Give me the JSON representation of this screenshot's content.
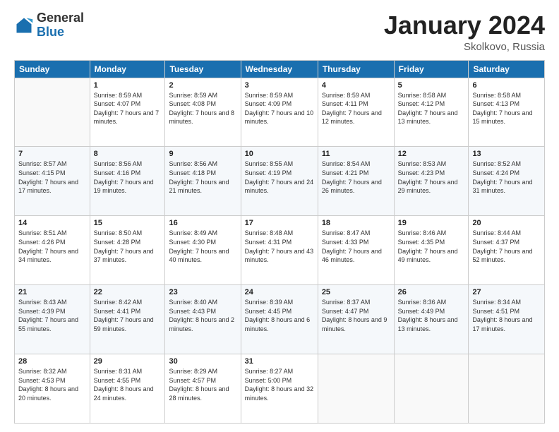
{
  "header": {
    "logo_general": "General",
    "logo_blue": "Blue",
    "month_title": "January 2024",
    "location": "Skolkovo, Russia"
  },
  "weekdays": [
    "Sunday",
    "Monday",
    "Tuesday",
    "Wednesday",
    "Thursday",
    "Friday",
    "Saturday"
  ],
  "weeks": [
    [
      {
        "day": "",
        "sunrise": "",
        "sunset": "",
        "daylight": ""
      },
      {
        "day": "1",
        "sunrise": "Sunrise: 8:59 AM",
        "sunset": "Sunset: 4:07 PM",
        "daylight": "Daylight: 7 hours and 7 minutes."
      },
      {
        "day": "2",
        "sunrise": "Sunrise: 8:59 AM",
        "sunset": "Sunset: 4:08 PM",
        "daylight": "Daylight: 7 hours and 8 minutes."
      },
      {
        "day": "3",
        "sunrise": "Sunrise: 8:59 AM",
        "sunset": "Sunset: 4:09 PM",
        "daylight": "Daylight: 7 hours and 10 minutes."
      },
      {
        "day": "4",
        "sunrise": "Sunrise: 8:59 AM",
        "sunset": "Sunset: 4:11 PM",
        "daylight": "Daylight: 7 hours and 12 minutes."
      },
      {
        "day": "5",
        "sunrise": "Sunrise: 8:58 AM",
        "sunset": "Sunset: 4:12 PM",
        "daylight": "Daylight: 7 hours and 13 minutes."
      },
      {
        "day": "6",
        "sunrise": "Sunrise: 8:58 AM",
        "sunset": "Sunset: 4:13 PM",
        "daylight": "Daylight: 7 hours and 15 minutes."
      }
    ],
    [
      {
        "day": "7",
        "sunrise": "Sunrise: 8:57 AM",
        "sunset": "Sunset: 4:15 PM",
        "daylight": "Daylight: 7 hours and 17 minutes."
      },
      {
        "day": "8",
        "sunrise": "Sunrise: 8:56 AM",
        "sunset": "Sunset: 4:16 PM",
        "daylight": "Daylight: 7 hours and 19 minutes."
      },
      {
        "day": "9",
        "sunrise": "Sunrise: 8:56 AM",
        "sunset": "Sunset: 4:18 PM",
        "daylight": "Daylight: 7 hours and 21 minutes."
      },
      {
        "day": "10",
        "sunrise": "Sunrise: 8:55 AM",
        "sunset": "Sunset: 4:19 PM",
        "daylight": "Daylight: 7 hours and 24 minutes."
      },
      {
        "day": "11",
        "sunrise": "Sunrise: 8:54 AM",
        "sunset": "Sunset: 4:21 PM",
        "daylight": "Daylight: 7 hours and 26 minutes."
      },
      {
        "day": "12",
        "sunrise": "Sunrise: 8:53 AM",
        "sunset": "Sunset: 4:23 PM",
        "daylight": "Daylight: 7 hours and 29 minutes."
      },
      {
        "day": "13",
        "sunrise": "Sunrise: 8:52 AM",
        "sunset": "Sunset: 4:24 PM",
        "daylight": "Daylight: 7 hours and 31 minutes."
      }
    ],
    [
      {
        "day": "14",
        "sunrise": "Sunrise: 8:51 AM",
        "sunset": "Sunset: 4:26 PM",
        "daylight": "Daylight: 7 hours and 34 minutes."
      },
      {
        "day": "15",
        "sunrise": "Sunrise: 8:50 AM",
        "sunset": "Sunset: 4:28 PM",
        "daylight": "Daylight: 7 hours and 37 minutes."
      },
      {
        "day": "16",
        "sunrise": "Sunrise: 8:49 AM",
        "sunset": "Sunset: 4:30 PM",
        "daylight": "Daylight: 7 hours and 40 minutes."
      },
      {
        "day": "17",
        "sunrise": "Sunrise: 8:48 AM",
        "sunset": "Sunset: 4:31 PM",
        "daylight": "Daylight: 7 hours and 43 minutes."
      },
      {
        "day": "18",
        "sunrise": "Sunrise: 8:47 AM",
        "sunset": "Sunset: 4:33 PM",
        "daylight": "Daylight: 7 hours and 46 minutes."
      },
      {
        "day": "19",
        "sunrise": "Sunrise: 8:46 AM",
        "sunset": "Sunset: 4:35 PM",
        "daylight": "Daylight: 7 hours and 49 minutes."
      },
      {
        "day": "20",
        "sunrise": "Sunrise: 8:44 AM",
        "sunset": "Sunset: 4:37 PM",
        "daylight": "Daylight: 7 hours and 52 minutes."
      }
    ],
    [
      {
        "day": "21",
        "sunrise": "Sunrise: 8:43 AM",
        "sunset": "Sunset: 4:39 PM",
        "daylight": "Daylight: 7 hours and 55 minutes."
      },
      {
        "day": "22",
        "sunrise": "Sunrise: 8:42 AM",
        "sunset": "Sunset: 4:41 PM",
        "daylight": "Daylight: 7 hours and 59 minutes."
      },
      {
        "day": "23",
        "sunrise": "Sunrise: 8:40 AM",
        "sunset": "Sunset: 4:43 PM",
        "daylight": "Daylight: 8 hours and 2 minutes."
      },
      {
        "day": "24",
        "sunrise": "Sunrise: 8:39 AM",
        "sunset": "Sunset: 4:45 PM",
        "daylight": "Daylight: 8 hours and 6 minutes."
      },
      {
        "day": "25",
        "sunrise": "Sunrise: 8:37 AM",
        "sunset": "Sunset: 4:47 PM",
        "daylight": "Daylight: 8 hours and 9 minutes."
      },
      {
        "day": "26",
        "sunrise": "Sunrise: 8:36 AM",
        "sunset": "Sunset: 4:49 PM",
        "daylight": "Daylight: 8 hours and 13 minutes."
      },
      {
        "day": "27",
        "sunrise": "Sunrise: 8:34 AM",
        "sunset": "Sunset: 4:51 PM",
        "daylight": "Daylight: 8 hours and 17 minutes."
      }
    ],
    [
      {
        "day": "28",
        "sunrise": "Sunrise: 8:32 AM",
        "sunset": "Sunset: 4:53 PM",
        "daylight": "Daylight: 8 hours and 20 minutes."
      },
      {
        "day": "29",
        "sunrise": "Sunrise: 8:31 AM",
        "sunset": "Sunset: 4:55 PM",
        "daylight": "Daylight: 8 hours and 24 minutes."
      },
      {
        "day": "30",
        "sunrise": "Sunrise: 8:29 AM",
        "sunset": "Sunset: 4:57 PM",
        "daylight": "Daylight: 8 hours and 28 minutes."
      },
      {
        "day": "31",
        "sunrise": "Sunrise: 8:27 AM",
        "sunset": "Sunset: 5:00 PM",
        "daylight": "Daylight: 8 hours and 32 minutes."
      },
      {
        "day": "",
        "sunrise": "",
        "sunset": "",
        "daylight": ""
      },
      {
        "day": "",
        "sunrise": "",
        "sunset": "",
        "daylight": ""
      },
      {
        "day": "",
        "sunrise": "",
        "sunset": "",
        "daylight": ""
      }
    ]
  ]
}
